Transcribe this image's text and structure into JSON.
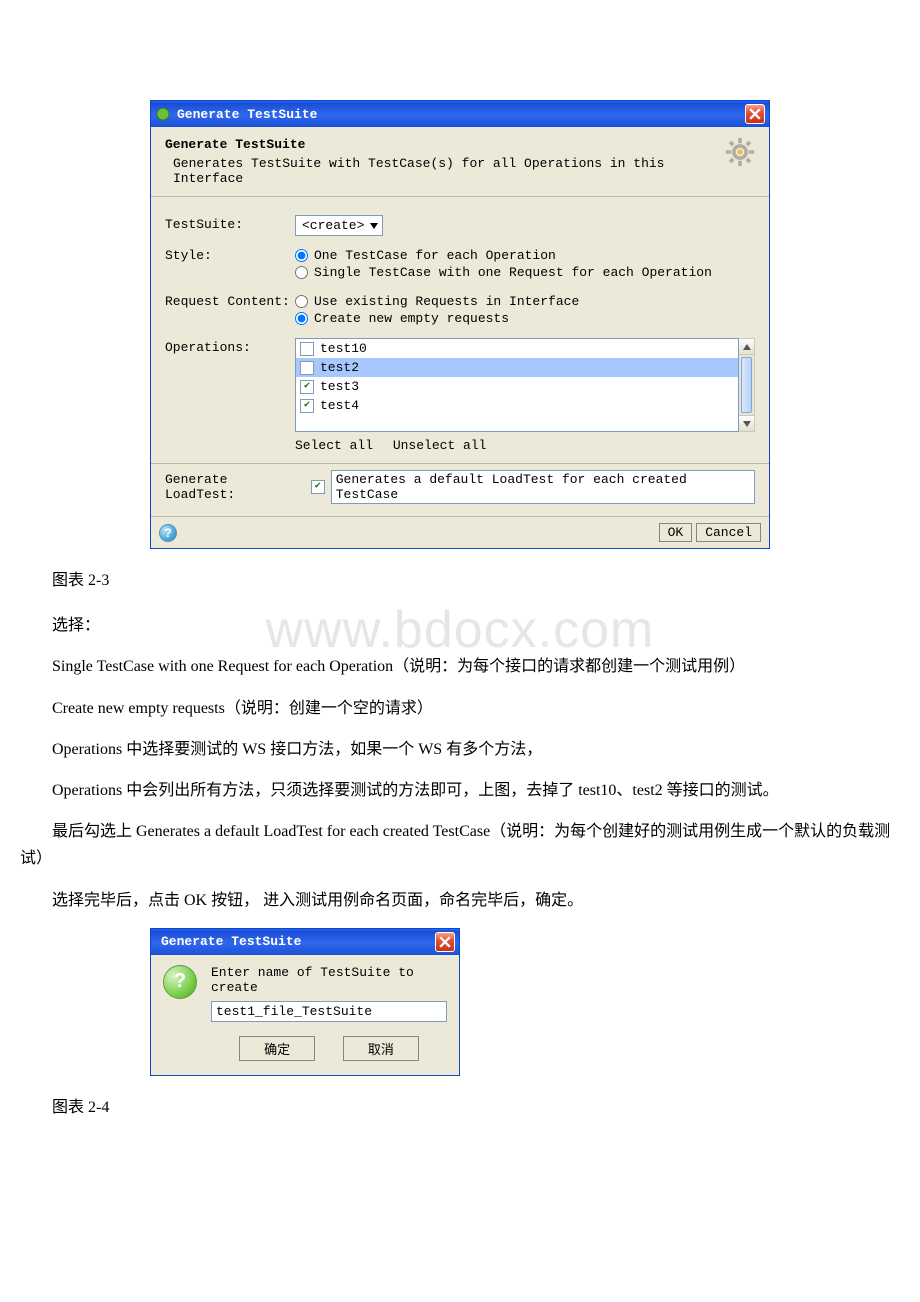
{
  "watermark": "www.bdocx.com",
  "dialog1": {
    "title": "Generate TestSuite",
    "header_title": "Generate TestSuite",
    "header_desc": "Generates TestSuite with TestCase(s) for all Operations in this Interface",
    "labels": {
      "testsuite": "TestSuite:",
      "style": "Style:",
      "request_content": "Request Content:",
      "operations": "Operations:",
      "generate_loadtest": "Generate LoadTest:"
    },
    "testsuite_combo": "<create>",
    "style_opt1": "One TestCase for each Operation",
    "style_opt2": "Single TestCase with one Request for each Operation",
    "reqcontent_opt1": "Use existing Requests in Interface",
    "reqcontent_opt2": "Create new empty requests",
    "operations": [
      {
        "name": "test10",
        "checked": false
      },
      {
        "name": "test2",
        "checked": false
      },
      {
        "name": "test3",
        "checked": true
      },
      {
        "name": "test4",
        "checked": true
      }
    ],
    "select_all": "Select all",
    "unselect_all": "Unselect all",
    "generate_loadtest_text": "Generates a default LoadTest for each created TestCase",
    "ok": "OK",
    "cancel": "Cancel"
  },
  "caption_23": "图表 2-3",
  "para_select": "选择：",
  "para1": "Single TestCase with one Request for each Operation（说明：为每个接口的请求都创建一个测试用例）",
  "para2": "Create new empty requests（说明：创建一个空的请求）",
  "para3": "Operations 中选择要测试的 WS 接口方法，如果一个 WS 有多个方法，",
  "para4": "Operations 中会列出所有方法，只须选择要测试的方法即可，上图，去掉了 test10、test2 等接口的测试。",
  "para5": "最后勾选上 Generates a default LoadTest for each created TestCase（说明：为每个创建好的测试用例生成一个默认的负载测试）",
  "para6": "选择完毕后，点击 OK 按钮， 进入测试用例命名页面，命名完毕后，确定。",
  "dialog2": {
    "title": "Generate TestSuite",
    "prompt": "Enter name of TestSuite to create",
    "input_value": "test1_file_TestSuite",
    "ok": "确定",
    "cancel": "取消"
  },
  "caption_24": "图表 2-4"
}
